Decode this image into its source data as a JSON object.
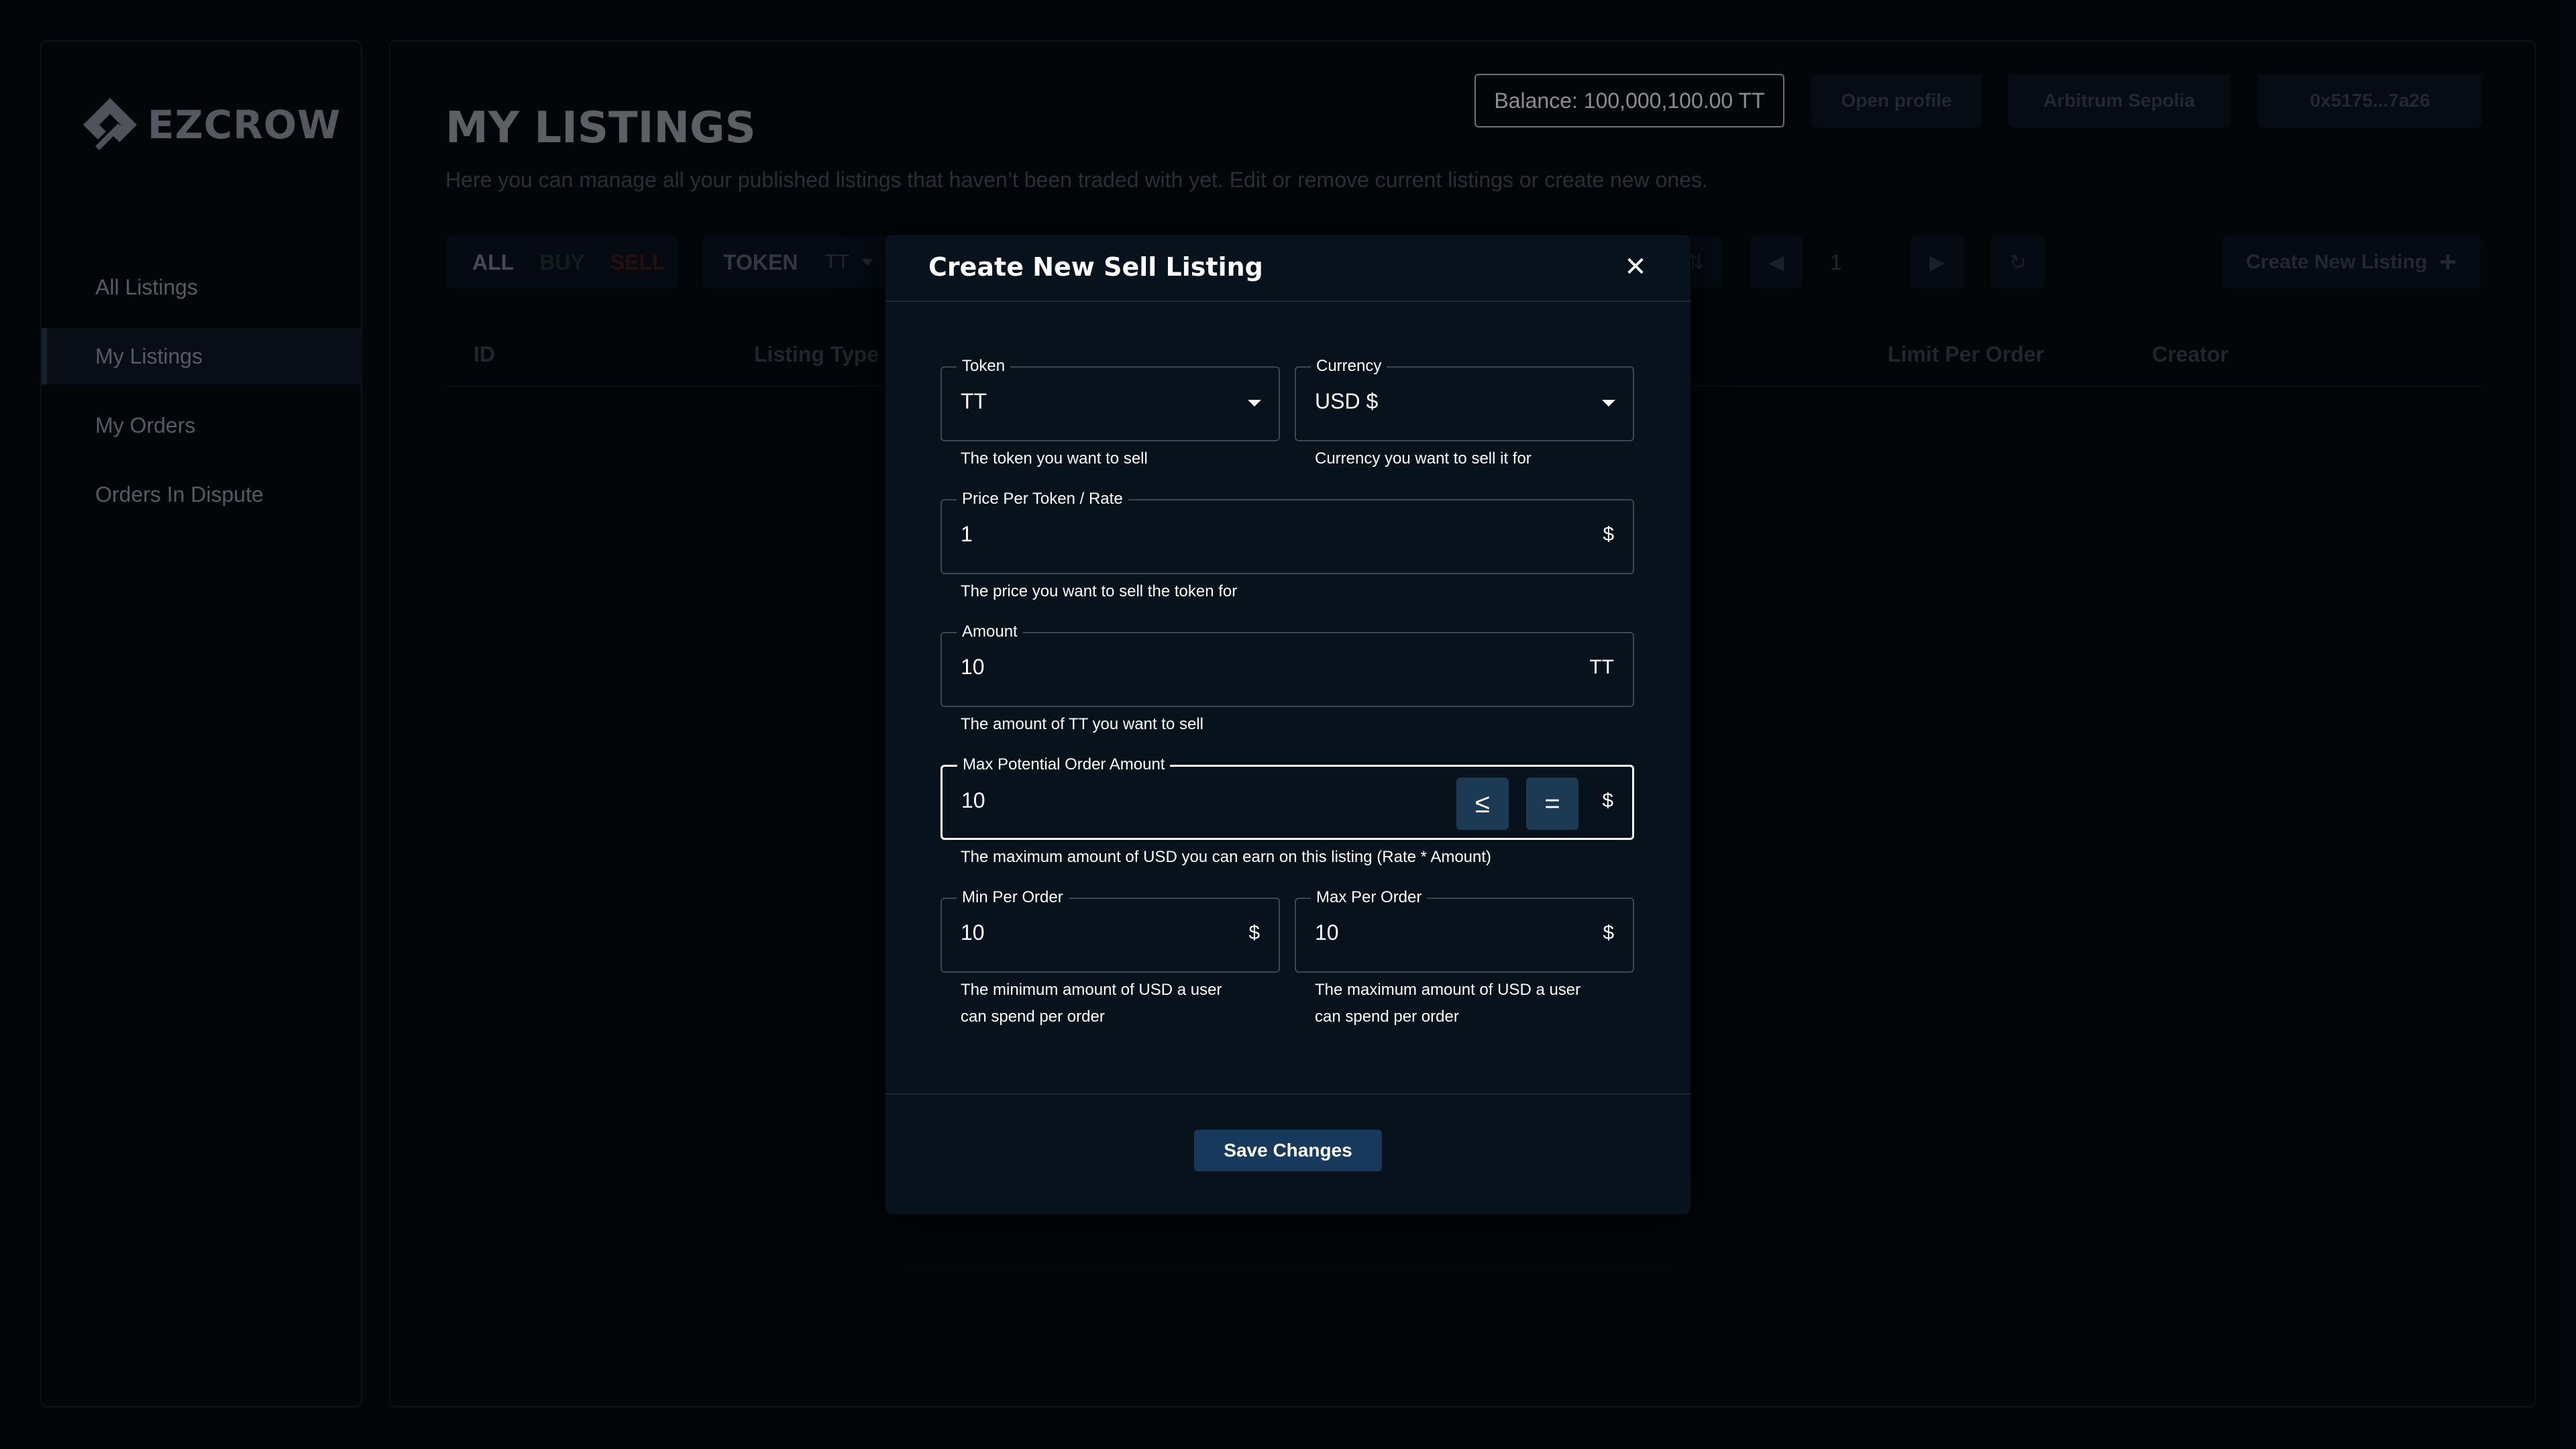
{
  "brand": {
    "name": "EZCROW"
  },
  "sidebar": {
    "items": [
      {
        "label": "All Listings"
      },
      {
        "label": "My Listings"
      },
      {
        "label": "My Orders"
      },
      {
        "label": "Orders In Dispute"
      }
    ]
  },
  "header": {
    "title": "MY LISTINGS",
    "description": "Here you can manage all your published listings that haven’t been traded with yet. Edit or remove current listings or create new ones.",
    "balance": "Balance: 100,000,100.00 TT",
    "open_profile": "Open profile",
    "network": "Arbitrum Sepolia",
    "wallet": "0x5175...7a26"
  },
  "toolbar": {
    "type_all": "ALL",
    "type_buy": "BUY",
    "type_sell": "SELL",
    "token_label": "TOKEN",
    "token_value": "TT",
    "page_number": "1",
    "create_label": "Create New Listing"
  },
  "table": {
    "headers": [
      "ID",
      "Listing Type",
      "Limit Per Order",
      "Creator"
    ]
  },
  "modal": {
    "title": "Create New Sell Listing",
    "token": {
      "label": "Token",
      "value": "TT",
      "helper": "The token you want to sell"
    },
    "currency": {
      "label": "Currency",
      "value": "USD $",
      "helper": "Currency you want to sell it for"
    },
    "price": {
      "label": "Price Per Token / Rate",
      "value": "1",
      "suffix": "$",
      "helper": "The price you want to sell the token for"
    },
    "amount": {
      "label": "Amount",
      "value": "10",
      "suffix": "TT",
      "helper": "The amount of TT you want to sell"
    },
    "max_potential": {
      "label": "Max Potential Order Amount",
      "value": "10",
      "suffix": "$",
      "toggle_lte": "≤",
      "toggle_eq": "=",
      "helper": "The maximum amount of USD you can earn on this listing (Rate * Amount)"
    },
    "min_per_order": {
      "label": "Min Per Order",
      "value": "10",
      "suffix": "$",
      "helper_1": "The minimum amount of USD a user",
      "helper_2": "can spend per order"
    },
    "max_per_order": {
      "label": "Max Per Order",
      "value": "10",
      "suffix": "$",
      "helper_1": "The maximum amount of USD a user",
      "helper_2": "can spend per order"
    },
    "save_label": "Save Changes"
  },
  "colors": {
    "background": "#050b12",
    "modal": "#08121c",
    "accent": "#173a5c",
    "toggle": "#1d3a55",
    "buy": "#1d3a34",
    "sell": "#4a1a1a"
  },
  "icons": [
    "ezcrow-logo-icon",
    "close-icon",
    "caret-down-icon",
    "sort-icon",
    "chevron-left-icon",
    "chevron-right-icon",
    "refresh-icon",
    "plus-icon"
  ]
}
